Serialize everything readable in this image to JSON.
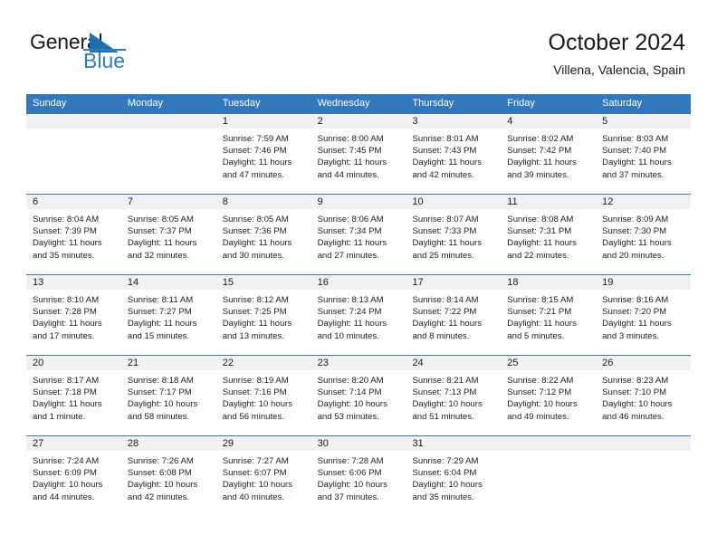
{
  "brand": {
    "name_top": "General",
    "name_bottom": "Blue",
    "accent_color": "#2E7DC1"
  },
  "header": {
    "month_year": "October 2024",
    "location": "Villena, Valencia, Spain",
    "header_bg": "#3178BE"
  },
  "weekdays": [
    "Sunday",
    "Monday",
    "Tuesday",
    "Wednesday",
    "Thursday",
    "Friday",
    "Saturday"
  ],
  "weeks": [
    [
      {
        "day": "",
        "sunrise": "",
        "sunset": "",
        "daylight1": "",
        "daylight2": ""
      },
      {
        "day": "",
        "sunrise": "",
        "sunset": "",
        "daylight1": "",
        "daylight2": ""
      },
      {
        "day": "1",
        "sunrise": "Sunrise: 7:59 AM",
        "sunset": "Sunset: 7:46 PM",
        "daylight1": "Daylight: 11 hours",
        "daylight2": "and 47 minutes."
      },
      {
        "day": "2",
        "sunrise": "Sunrise: 8:00 AM",
        "sunset": "Sunset: 7:45 PM",
        "daylight1": "Daylight: 11 hours",
        "daylight2": "and 44 minutes."
      },
      {
        "day": "3",
        "sunrise": "Sunrise: 8:01 AM",
        "sunset": "Sunset: 7:43 PM",
        "daylight1": "Daylight: 11 hours",
        "daylight2": "and 42 minutes."
      },
      {
        "day": "4",
        "sunrise": "Sunrise: 8:02 AM",
        "sunset": "Sunset: 7:42 PM",
        "daylight1": "Daylight: 11 hours",
        "daylight2": "and 39 minutes."
      },
      {
        "day": "5",
        "sunrise": "Sunrise: 8:03 AM",
        "sunset": "Sunset: 7:40 PM",
        "daylight1": "Daylight: 11 hours",
        "daylight2": "and 37 minutes."
      }
    ],
    [
      {
        "day": "6",
        "sunrise": "Sunrise: 8:04 AM",
        "sunset": "Sunset: 7:39 PM",
        "daylight1": "Daylight: 11 hours",
        "daylight2": "and 35 minutes."
      },
      {
        "day": "7",
        "sunrise": "Sunrise: 8:05 AM",
        "sunset": "Sunset: 7:37 PM",
        "daylight1": "Daylight: 11 hours",
        "daylight2": "and 32 minutes."
      },
      {
        "day": "8",
        "sunrise": "Sunrise: 8:05 AM",
        "sunset": "Sunset: 7:36 PM",
        "daylight1": "Daylight: 11 hours",
        "daylight2": "and 30 minutes."
      },
      {
        "day": "9",
        "sunrise": "Sunrise: 8:06 AM",
        "sunset": "Sunset: 7:34 PM",
        "daylight1": "Daylight: 11 hours",
        "daylight2": "and 27 minutes."
      },
      {
        "day": "10",
        "sunrise": "Sunrise: 8:07 AM",
        "sunset": "Sunset: 7:33 PM",
        "daylight1": "Daylight: 11 hours",
        "daylight2": "and 25 minutes."
      },
      {
        "day": "11",
        "sunrise": "Sunrise: 8:08 AM",
        "sunset": "Sunset: 7:31 PM",
        "daylight1": "Daylight: 11 hours",
        "daylight2": "and 22 minutes."
      },
      {
        "day": "12",
        "sunrise": "Sunrise: 8:09 AM",
        "sunset": "Sunset: 7:30 PM",
        "daylight1": "Daylight: 11 hours",
        "daylight2": "and 20 minutes."
      }
    ],
    [
      {
        "day": "13",
        "sunrise": "Sunrise: 8:10 AM",
        "sunset": "Sunset: 7:28 PM",
        "daylight1": "Daylight: 11 hours",
        "daylight2": "and 17 minutes."
      },
      {
        "day": "14",
        "sunrise": "Sunrise: 8:11 AM",
        "sunset": "Sunset: 7:27 PM",
        "daylight1": "Daylight: 11 hours",
        "daylight2": "and 15 minutes."
      },
      {
        "day": "15",
        "sunrise": "Sunrise: 8:12 AM",
        "sunset": "Sunset: 7:25 PM",
        "daylight1": "Daylight: 11 hours",
        "daylight2": "and 13 minutes."
      },
      {
        "day": "16",
        "sunrise": "Sunrise: 8:13 AM",
        "sunset": "Sunset: 7:24 PM",
        "daylight1": "Daylight: 11 hours",
        "daylight2": "and 10 minutes."
      },
      {
        "day": "17",
        "sunrise": "Sunrise: 8:14 AM",
        "sunset": "Sunset: 7:22 PM",
        "daylight1": "Daylight: 11 hours",
        "daylight2": "and 8 minutes."
      },
      {
        "day": "18",
        "sunrise": "Sunrise: 8:15 AM",
        "sunset": "Sunset: 7:21 PM",
        "daylight1": "Daylight: 11 hours",
        "daylight2": "and 5 minutes."
      },
      {
        "day": "19",
        "sunrise": "Sunrise: 8:16 AM",
        "sunset": "Sunset: 7:20 PM",
        "daylight1": "Daylight: 11 hours",
        "daylight2": "and 3 minutes."
      }
    ],
    [
      {
        "day": "20",
        "sunrise": "Sunrise: 8:17 AM",
        "sunset": "Sunset: 7:18 PM",
        "daylight1": "Daylight: 11 hours",
        "daylight2": "and 1 minute."
      },
      {
        "day": "21",
        "sunrise": "Sunrise: 8:18 AM",
        "sunset": "Sunset: 7:17 PM",
        "daylight1": "Daylight: 10 hours",
        "daylight2": "and 58 minutes."
      },
      {
        "day": "22",
        "sunrise": "Sunrise: 8:19 AM",
        "sunset": "Sunset: 7:16 PM",
        "daylight1": "Daylight: 10 hours",
        "daylight2": "and 56 minutes."
      },
      {
        "day": "23",
        "sunrise": "Sunrise: 8:20 AM",
        "sunset": "Sunset: 7:14 PM",
        "daylight1": "Daylight: 10 hours",
        "daylight2": "and 53 minutes."
      },
      {
        "day": "24",
        "sunrise": "Sunrise: 8:21 AM",
        "sunset": "Sunset: 7:13 PM",
        "daylight1": "Daylight: 10 hours",
        "daylight2": "and 51 minutes."
      },
      {
        "day": "25",
        "sunrise": "Sunrise: 8:22 AM",
        "sunset": "Sunset: 7:12 PM",
        "daylight1": "Daylight: 10 hours",
        "daylight2": "and 49 minutes."
      },
      {
        "day": "26",
        "sunrise": "Sunrise: 8:23 AM",
        "sunset": "Sunset: 7:10 PM",
        "daylight1": "Daylight: 10 hours",
        "daylight2": "and 46 minutes."
      }
    ],
    [
      {
        "day": "27",
        "sunrise": "Sunrise: 7:24 AM",
        "sunset": "Sunset: 6:09 PM",
        "daylight1": "Daylight: 10 hours",
        "daylight2": "and 44 minutes."
      },
      {
        "day": "28",
        "sunrise": "Sunrise: 7:26 AM",
        "sunset": "Sunset: 6:08 PM",
        "daylight1": "Daylight: 10 hours",
        "daylight2": "and 42 minutes."
      },
      {
        "day": "29",
        "sunrise": "Sunrise: 7:27 AM",
        "sunset": "Sunset: 6:07 PM",
        "daylight1": "Daylight: 10 hours",
        "daylight2": "and 40 minutes."
      },
      {
        "day": "30",
        "sunrise": "Sunrise: 7:28 AM",
        "sunset": "Sunset: 6:06 PM",
        "daylight1": "Daylight: 10 hours",
        "daylight2": "and 37 minutes."
      },
      {
        "day": "31",
        "sunrise": "Sunrise: 7:29 AM",
        "sunset": "Sunset: 6:04 PM",
        "daylight1": "Daylight: 10 hours",
        "daylight2": "and 35 minutes."
      },
      {
        "day": "",
        "sunrise": "",
        "sunset": "",
        "daylight1": "",
        "daylight2": ""
      },
      {
        "day": "",
        "sunrise": "",
        "sunset": "",
        "daylight1": "",
        "daylight2": ""
      }
    ]
  ]
}
